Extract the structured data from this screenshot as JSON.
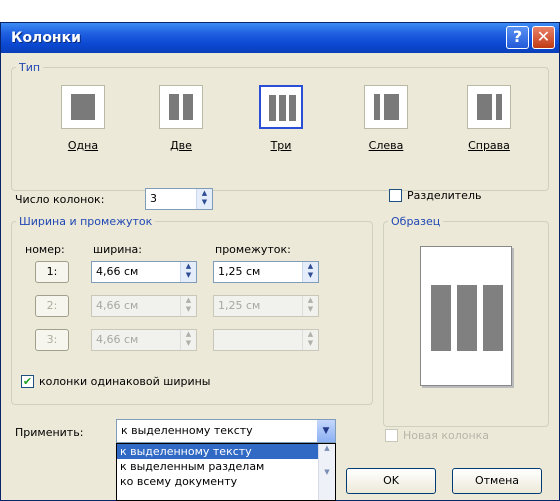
{
  "window": {
    "title": "Колонки"
  },
  "titlebar_buttons": {
    "help": "?",
    "close": "✕"
  },
  "type_group": {
    "legend": "Тип",
    "items": [
      {
        "label": "Одна",
        "selected": false
      },
      {
        "label": "Две",
        "selected": false
      },
      {
        "label": "Три",
        "selected": true
      },
      {
        "label": "Слева",
        "selected": false
      },
      {
        "label": "Справа",
        "selected": false
      }
    ]
  },
  "column_count": {
    "label": "Число колонок:",
    "value": "3"
  },
  "separator": {
    "label": "Разделитель",
    "checked": false
  },
  "width_group": {
    "legend": "Ширина и промежуток",
    "headers": {
      "number": "номер:",
      "width": "ширина:",
      "spacing": "промежуток:"
    },
    "rows": [
      {
        "number": "1:",
        "width": "4,66 см",
        "spacing": "1,25 см",
        "enabled": true
      },
      {
        "number": "2:",
        "width": "4,66 см",
        "spacing": "1,25 см",
        "enabled": false
      },
      {
        "number": "3:",
        "width": "4,66 см",
        "spacing": "",
        "enabled": false
      }
    ],
    "equal_width": {
      "label": "колонки одинаковой ширины",
      "checked": true
    }
  },
  "preview_group": {
    "legend": "Образец"
  },
  "apply": {
    "label": "Применить:",
    "value": "к выделенному тексту",
    "options": [
      "к выделенному тексту",
      "к выделенным разделам",
      "ко всему документу"
    ],
    "selected_index": 0
  },
  "new_column": {
    "label": "Новая колонка",
    "checked": false,
    "enabled": false
  },
  "buttons": {
    "ok": "OK",
    "cancel": "Отмена"
  },
  "colors": {
    "title_blue": "#0b49d3",
    "legend_blue": "#1f47b3",
    "dialog_bg": "#ece9d8",
    "selection": "#316ac5"
  }
}
